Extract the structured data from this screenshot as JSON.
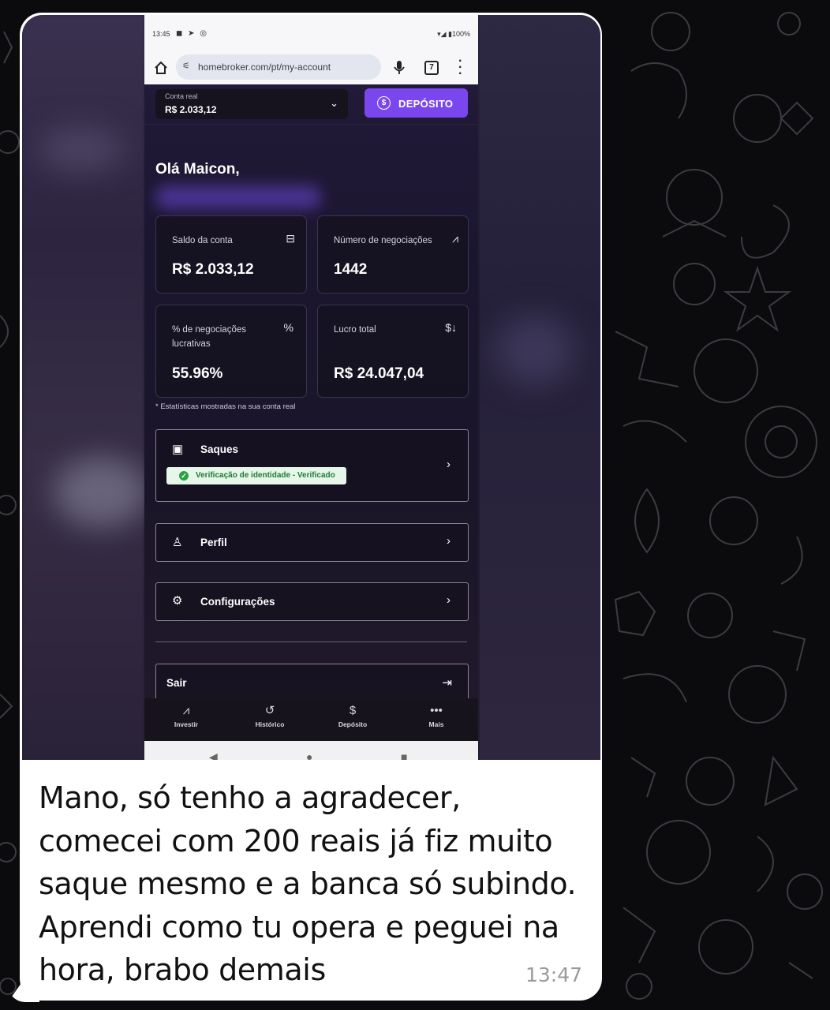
{
  "phone": {
    "status_time": "13:45",
    "status_right": "100%",
    "url": "homebroker.com/pt/my-account",
    "tab_count": "7"
  },
  "app": {
    "account_label": "Conta real",
    "account_value": "R$ 2.033,12",
    "deposit_button": "DEPÓSITO",
    "greeting": "Olá Maicon,",
    "stats": [
      {
        "title": "Saldo da conta",
        "value": "R$ 2.033,12",
        "icon": "cash-icon"
      },
      {
        "title": "Número de negociações",
        "value": "1442",
        "icon": "chart-up-icon"
      },
      {
        "title": "% de negociações lucrativas",
        "value": "55.96%",
        "icon": "percent-icon"
      },
      {
        "title": "Lucro total",
        "value": "R$ 24.047,04",
        "icon": "dollar-arrow-icon"
      }
    ],
    "stats_note": "* Estatísticas mostradas na sua conta real",
    "menu": {
      "withdraw": "Saques",
      "verification": "Verificação de identidade - Verificado",
      "profile": "Perfil",
      "settings": "Configurações",
      "logout": "Sair"
    },
    "bottom_nav": [
      "Investir",
      "Histórico",
      "Depósito",
      "Mais"
    ]
  },
  "message": {
    "lines": [
      "Mano, só tenho a agradecer,",
      "comecei com 200 reais já fiz muito",
      "saque mesmo e a banca só subindo.",
      "Aprendi como tu opera e peguei na",
      "hora, brabo demais"
    ],
    "time": "13:47"
  },
  "colors": {
    "accent": "#7a47ef",
    "verified": "#27a344",
    "bubble": "#ffffff",
    "wallpaper": "#0b0b0d"
  }
}
